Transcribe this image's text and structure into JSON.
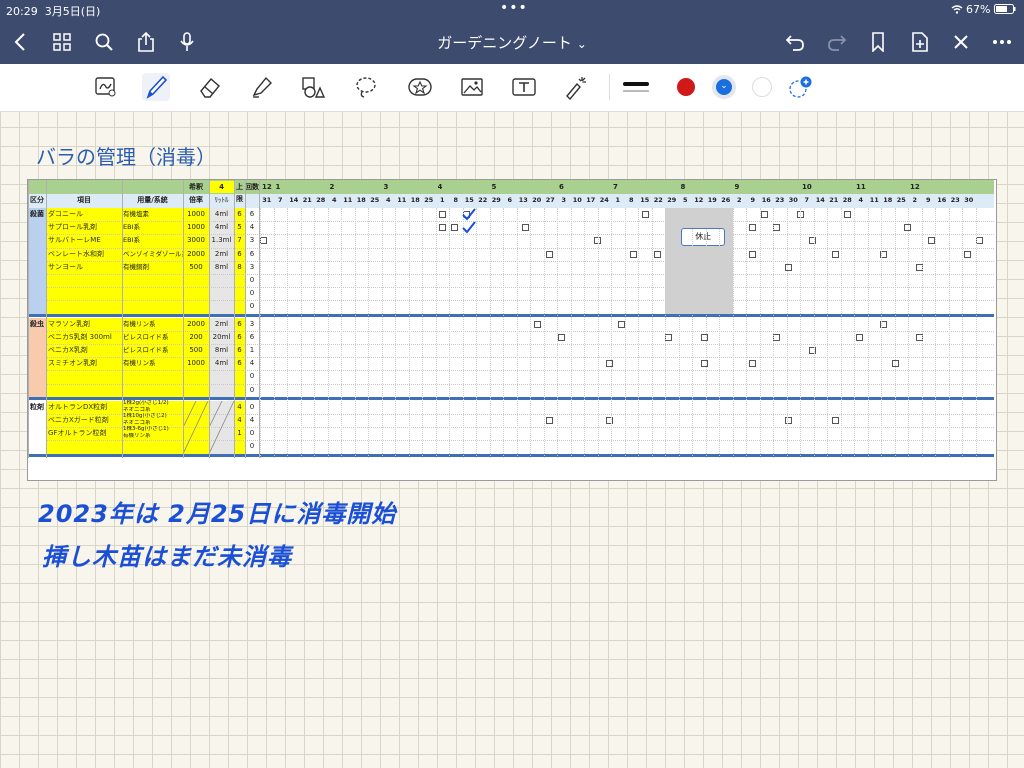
{
  "status": {
    "time": "20:29",
    "date": "3月5日(日)",
    "battery": "67%"
  },
  "nav": {
    "title": "ガーデニングノート",
    "chevron": "⌄"
  },
  "page": {
    "title": "バラの管理（消毒）",
    "note_line1": "2023年は 2月25日に消毒開始",
    "note_line2": "挿し木苗はまだ未消毒"
  },
  "table": {
    "headers": {
      "category": "区分",
      "item": "項目",
      "dosage": "用量/系統",
      "dilution_label": "希釈",
      "ratio": "倍率",
      "liters_value": "4",
      "liters": "ﾘｯﾄﾙ",
      "limit": "上限",
      "times": "回数"
    },
    "months": [
      "12",
      "1",
      "2",
      "3",
      "4",
      "5",
      "6",
      "7",
      "8",
      "9",
      "10",
      "11",
      "12"
    ],
    "days": [
      "31",
      "7",
      "14",
      "21",
      "28",
      "4",
      "11",
      "18",
      "25",
      "4",
      "11",
      "18",
      "25",
      "1",
      "8",
      "15",
      "22",
      "29",
      "6",
      "13",
      "20",
      "27",
      "3",
      "10",
      "17",
      "24",
      "1",
      "8",
      "15",
      "22",
      "29",
      "5",
      "12",
      "19",
      "26",
      "2",
      "9",
      "16",
      "23",
      "30",
      "7",
      "14",
      "21",
      "28",
      "4",
      "11",
      "18",
      "25",
      "2",
      "9",
      "16",
      "23",
      "30"
    ],
    "sections": [
      {
        "name": "殺菌",
        "rows": [
          {
            "item": "ダコニール",
            "type": "有機塩素",
            "ratio": "1000",
            "amount": "4ml",
            "limit": "6",
            "count": "6",
            "marks": [
              15,
              17,
              32,
              37,
              42,
              45,
              49
            ]
          },
          {
            "item": "サプロール乳剤",
            "type": "EBI系",
            "ratio": "1000",
            "amount": "4ml",
            "limit": "5",
            "count": "4",
            "marks": [
              15,
              16,
              22,
              41,
              43,
              54
            ]
          },
          {
            "item": "サルバトーレME",
            "type": "EBI系",
            "ratio": "3000",
            "amount": "1.3ml",
            "limit": "7",
            "count": "3",
            "marks": [
              0,
              28,
              46,
              56,
              60
            ]
          },
          {
            "item": "ベンレート水和剤",
            "type": "ベンゾイミダゾール系",
            "ratio": "2000",
            "amount": "2ml",
            "limit": "6",
            "count": "6",
            "marks": [
              24,
              31,
              33,
              41,
              48,
              52,
              59
            ]
          },
          {
            "item": "サンヨール",
            "type": "有機銅剤",
            "ratio": "500",
            "amount": "8ml",
            "limit": "8",
            "count": "3",
            "marks": [
              35,
              37,
              44,
              55
            ]
          },
          {
            "item": "",
            "type": "",
            "ratio": "",
            "amount": "",
            "limit": "",
            "count": "0",
            "marks": []
          },
          {
            "item": "",
            "type": "",
            "ratio": "",
            "amount": "",
            "limit": "",
            "count": "0",
            "marks": []
          },
          {
            "item": "",
            "type": "",
            "ratio": "",
            "amount": "",
            "limit": "",
            "count": "0",
            "marks": []
          }
        ]
      },
      {
        "name": "殺虫",
        "rows": [
          {
            "item": "マラソン乳剤",
            "type": "有機リン系",
            "ratio": "2000",
            "amount": "2ml",
            "limit": "6",
            "count": "3",
            "marks": [
              23,
              30,
              52
            ]
          },
          {
            "item": "ベニカS乳剤 300ml",
            "type": "ピレスロイド系",
            "ratio": "200",
            "amount": "20ml",
            "limit": "6",
            "count": "6",
            "marks": [
              25,
              34,
              37,
              43,
              50,
              55
            ]
          },
          {
            "item": "ベニカX乳剤",
            "type": "ピレスロイド系",
            "ratio": "500",
            "amount": "8ml",
            "limit": "6",
            "count": "1",
            "marks": [
              46
            ]
          },
          {
            "item": "スミチオン乳剤",
            "type": "有機リン系",
            "ratio": "1000",
            "amount": "4ml",
            "limit": "6",
            "count": "4",
            "marks": [
              29,
              37,
              41,
              53
            ]
          },
          {
            "item": "",
            "type": "",
            "ratio": "",
            "amount": "",
            "limit": "",
            "count": "0",
            "marks": []
          },
          {
            "item": "",
            "type": "",
            "ratio": "",
            "amount": "",
            "limit": "",
            "count": "0",
            "marks": []
          }
        ]
      },
      {
        "name": "粒剤",
        "rows": [
          {
            "item": "オルトランDX粒剤",
            "type": "1株2g(小さじ1/2)",
            "type2": "ネオニコ系",
            "ratio": "",
            "amount": "",
            "limit": "4",
            "count": "0",
            "marks": []
          },
          {
            "item": "ベニカXガード粒剤",
            "type": "1株10g(小さじ2)",
            "type2": "ネオニコ系",
            "ratio": "",
            "amount": "",
            "limit": "4",
            "count": "4",
            "marks": [
              24,
              29,
              44,
              48
            ]
          },
          {
            "item": "GFオルトラン粒剤",
            "type": "1株3-6g(小さじ1)",
            "type2": "有機リン系",
            "ratio": "",
            "amount": "",
            "limit": "1",
            "count": "0",
            "marks": []
          },
          {
            "item": "",
            "type": "",
            "ratio": "",
            "amount": "",
            "limit": "",
            "count": "0",
            "marks": []
          }
        ]
      }
    ],
    "rest_label": "休止",
    "checks": [
      [
        0,
        15
      ],
      [
        1,
        15
      ]
    ]
  },
  "colors": {
    "nav": "#3d4b6e",
    "header_green": "#a9d08e",
    "header_blue": "#ddebf7",
    "yellow": "#ffff00",
    "ink": "#1a4fd6",
    "cat1": "#b9d0ee",
    "cat2": "#f8cbad",
    "rest_gray": "#d0d0d0"
  },
  "icons": {
    "back": "chevron-left-icon",
    "grid": "grid-icon",
    "search": "search-icon",
    "share": "share-icon",
    "mic": "mic-icon",
    "undo": "undo-icon",
    "redo": "redo-icon",
    "bookmark": "bookmark-icon",
    "add_page": "add-page-icon",
    "close": "close-icon",
    "more": "more-icon"
  }
}
